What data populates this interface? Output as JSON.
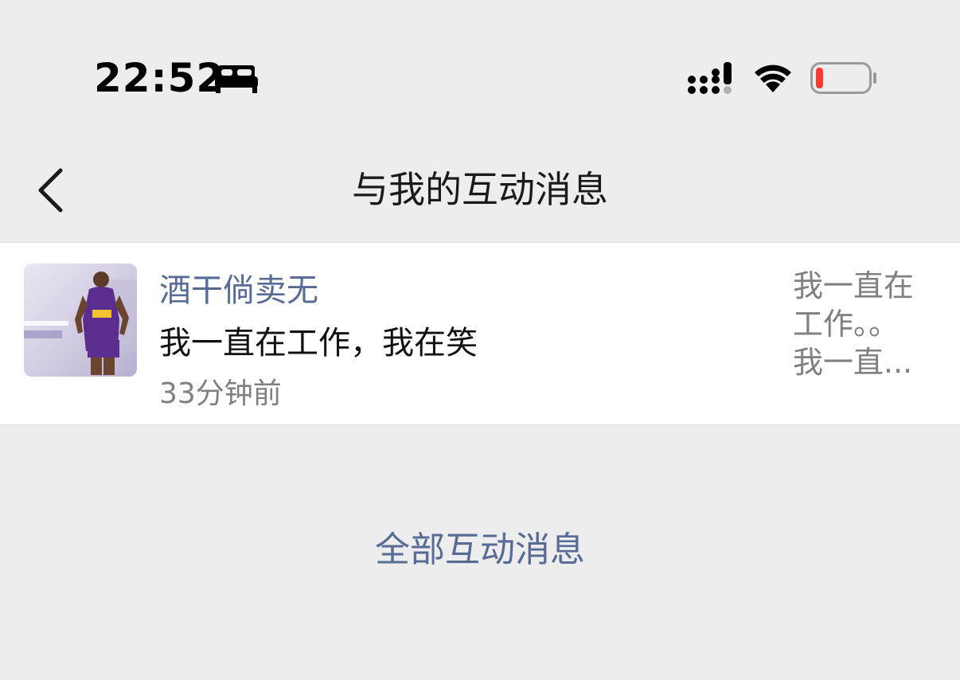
{
  "status_bar": {
    "time": "22:52",
    "focus_icon": "bed-icon",
    "signal_icon": "cellular-signal-icon",
    "wifi_icon": "wifi-icon",
    "battery_icon": "battery-low-icon",
    "battery_color": "#ff3b30"
  },
  "nav": {
    "back_icon": "chevron-left-icon",
    "title": "与我的互动消息"
  },
  "messages": [
    {
      "avatar_icon": "avatar-image",
      "name": "酒干倘卖无",
      "text": "我一直在工作，我在笑",
      "time": "33分钟前",
      "preview_lines": [
        "我一直在",
        "工作。。",
        "我一直..."
      ]
    }
  ],
  "footer": {
    "all_messages_label": "全部互动消息"
  },
  "colors": {
    "background": "#ededed",
    "link": "#576b95",
    "secondary_text": "#808080",
    "card": "#ffffff"
  }
}
